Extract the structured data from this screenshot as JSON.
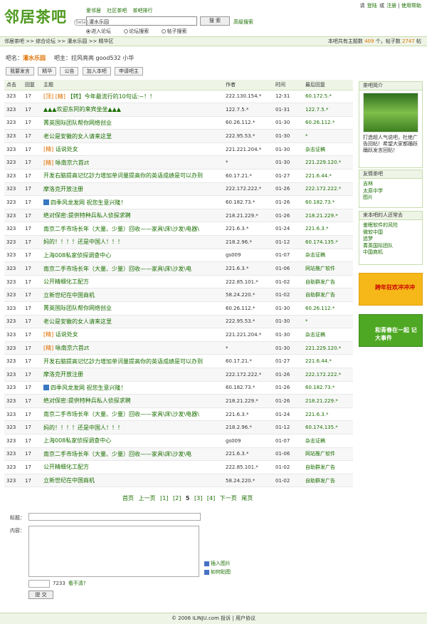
{
  "top_links": {
    "invite": "请",
    "login": "登陆",
    "or": "或",
    "register": "注册",
    "help": "使用帮助"
  },
  "logo": {
    "text": "邻居茶吧",
    "beta": "beta"
  },
  "nav": [
    "爱邻居",
    "社区茶吧",
    "茶吧排行"
  ],
  "search": {
    "value": "灌水乐园",
    "button": "搜 索",
    "advanced": "高级搜索"
  },
  "radios": [
    {
      "label": "进入论坛",
      "checked": true
    },
    {
      "label": "论坛搜索",
      "checked": false
    },
    {
      "label": "帖子搜索",
      "checked": false
    }
  ],
  "breadcrumb": "邻居茶吧 >> 综合论坛 >> 灌水乐园 >> 精华区",
  "stats": {
    "prefix": "本吧共有主题数",
    "topics": "409",
    "mid": "个，帖子数",
    "posts": "2747",
    "suffix": "帖"
  },
  "bar_info": {
    "label": "吧名：",
    "name": "灌水乐园",
    "owner": "吧主：拉风亮亮 good532 小华"
  },
  "tabs": [
    "我要发言",
    "精华",
    "公告",
    "加入本吧",
    "申请吧主"
  ],
  "columns": [
    "点击",
    "回复",
    "主题",
    "作者",
    "时间",
    "最后回复"
  ],
  "rows": [
    {
      "c": "323",
      "r": "17",
      "tag": "[顶] [精]",
      "t": "【转】今年最流行的10句话:~！！",
      "a": "222.130.154.*",
      "d": "12-31",
      "l": "60.172.5.*"
    },
    {
      "c": "323",
      "r": "17",
      "tag": "",
      "t": "▲▲▲欢迎东阿的来宾坐坐▲▲▲",
      "a": "122.7.5.*",
      "d": "01-31",
      "l": "122.7.5.*"
    },
    {
      "c": "323",
      "r": "17",
      "tag": "",
      "t": "菁英国际团队帮你网络创业",
      "a": "60.26.112.*",
      "d": "01-30",
      "l": "60.26.112.*"
    },
    {
      "c": "323",
      "r": "17",
      "tag": "",
      "t": "老公是安徽的女人请来这里",
      "a": "222.95.53.*",
      "d": "01-30",
      "l": "*"
    },
    {
      "c": "323",
      "r": "17",
      "tag": "[精]",
      "t": "话说处女",
      "a": "221.221.204.*",
      "d": "01-30",
      "l": "杂志证稿"
    },
    {
      "c": "323",
      "r": "17",
      "tag": "[精]",
      "t": "咏南京六首zt",
      "a": "*",
      "d": "01-30",
      "l": "221.229.120.*"
    },
    {
      "c": "323",
      "r": "17",
      "tag": "",
      "t": "开发右脑提高记忆訬力增加单词量提高你的英语成绩是可以办到",
      "a": "60.17.21.*",
      "d": "01-27",
      "l": "221.6.44.*"
    },
    {
      "c": "323",
      "r": "17",
      "tag": "",
      "t": "摩洛克开放注册",
      "a": "222.172.222.*",
      "d": "01-26",
      "l": "222.172.222.*"
    },
    {
      "c": "323",
      "r": "17",
      "tag": "icon",
      "t": "四季风龙发网  祝您生意兴隆！",
      "a": "60.182.73.*",
      "d": "01-26",
      "l": "60.182.73.*"
    },
    {
      "c": "323",
      "r": "17",
      "tag": "",
      "t": "绝对保密:提供特种兵私人侦探求聘",
      "a": "218.21.229.*",
      "d": "01-26",
      "l": "218.21.229.*"
    },
    {
      "c": "323",
      "r": "17",
      "tag": "",
      "t": "南京二手市场长年（大量、少量）回收——家具\\床\\沙发\\电器\\",
      "a": "221.6.3.*",
      "d": "01-24",
      "l": "221.6.3.*"
    },
    {
      "c": "323",
      "r": "17",
      "tag": "",
      "t": "妈的！！！！还是中国人！！！",
      "a": "218.2.96.*",
      "d": "01-12",
      "l": "60.174.135.*"
    },
    {
      "c": "323",
      "r": "17",
      "tag": "",
      "t": "上海008私家侦探调查中心",
      "a": "gs009",
      "d": "01-07",
      "l": "杂志证稿"
    },
    {
      "c": "323",
      "r": "17",
      "tag": "",
      "t": "南京二手市场长年（大量、少量）回收——家具\\床\\沙发\\电",
      "a": "221.6.3.*",
      "d": "01-06",
      "l": "网站推广软件"
    },
    {
      "c": "323",
      "r": "17",
      "tag": "",
      "t": "公开精细化工配方",
      "a": "222.85.101.*",
      "d": "01-02",
      "l": "自助群发广告"
    },
    {
      "c": "323",
      "r": "17",
      "tag": "",
      "t": "立新世纪在中国商机",
      "a": "58.24.220.*",
      "d": "01-02",
      "l": "自助群发广告"
    },
    {
      "c": "323",
      "r": "17",
      "tag": "",
      "t": "菁英国际团队帮你网络创业",
      "a": "60.26.112.*",
      "d": "01-30",
      "l": "60.26.112.*"
    },
    {
      "c": "323",
      "r": "17",
      "tag": "",
      "t": "老公是安徽的女人请来这里",
      "a": "222.95.53.*",
      "d": "01-30",
      "l": "*"
    },
    {
      "c": "323",
      "r": "17",
      "tag": "[精]",
      "t": "话说处女",
      "a": "221.221.204.*",
      "d": "01-30",
      "l": "杂志证稿"
    },
    {
      "c": "323",
      "r": "17",
      "tag": "[精]",
      "t": "咏南京六首zt",
      "a": "*",
      "d": "01-30",
      "l": "221.229.120.*"
    },
    {
      "c": "323",
      "r": "17",
      "tag": "",
      "t": "开发右脑提高记忆訬力增加单词量提高你的英语成绩是可以办到",
      "a": "60.17.21.*",
      "d": "01-27",
      "l": "221.6.44.*"
    },
    {
      "c": "323",
      "r": "17",
      "tag": "",
      "t": "摩洛克开放注册",
      "a": "222.172.222.*",
      "d": "01-26",
      "l": "222.172.222.*"
    },
    {
      "c": "323",
      "r": "17",
      "tag": "icon",
      "t": "四季风龙发网  祝您生意兴隆！",
      "a": "60.182.73.*",
      "d": "01-26",
      "l": "60.182.73.*"
    },
    {
      "c": "323",
      "r": "17",
      "tag": "",
      "t": "绝对保密:提供特种兵私人侦探求聘",
      "a": "218.21.229.*",
      "d": "01-26",
      "l": "218.21.229.*"
    },
    {
      "c": "323",
      "r": "17",
      "tag": "",
      "t": "南京二手市场长年（大量、少量）回收——家具\\床\\沙发\\电器\\",
      "a": "221.6.3.*",
      "d": "01-24",
      "l": "221.6.3.*"
    },
    {
      "c": "323",
      "r": "17",
      "tag": "",
      "t": "妈的！！！！还是中国人！！！",
      "a": "218.2.96.*",
      "d": "01-12",
      "l": "60.174.135.*"
    },
    {
      "c": "323",
      "r": "17",
      "tag": "",
      "t": "上海008私家侦探调查中心",
      "a": "gs009",
      "d": "01-07",
      "l": "杂志证稿"
    },
    {
      "c": "323",
      "r": "17",
      "tag": "",
      "t": "南京二手市场长年（大量、少量）回收——家具\\床\\沙发\\电",
      "a": "221.6.3.*",
      "d": "01-06",
      "l": "网站推广软件"
    },
    {
      "c": "323",
      "r": "17",
      "tag": "",
      "t": "公开精细化工配方",
      "a": "222.85.101.*",
      "d": "01-02",
      "l": "自助群发广告"
    },
    {
      "c": "323",
      "r": "17",
      "tag": "",
      "t": "立新世纪在中国商机",
      "a": "58.24.220.*",
      "d": "01-02",
      "l": "自助群发广告"
    }
  ],
  "pager": [
    "首页",
    "上一页",
    "[1]",
    "[2]",
    "5",
    "[3]",
    "[4]",
    "下一页",
    "尾页"
  ],
  "side_intro": {
    "title": "茶吧简介",
    "text": "打造超人气说吧，杜绝广告回帖！希望大家都踊跃踊跃发言回贴！"
  },
  "side_friends": {
    "title": "友情茶吧",
    "items": [
      "吉林",
      "太原中学",
      "图片"
    ]
  },
  "side_visitors": {
    "title": "来本吧的人还常去",
    "items": [
      "鉴眠软件的风险",
      "微软中国",
      "追梦",
      "菁英国际团队",
      "中国商机"
    ]
  },
  "ads": [
    "跨年狂欢冲冲冲",
    "和青春在一起 记大事件"
  ],
  "form": {
    "title_label": "标题：",
    "content_label": "内容：",
    "insert_image": "插入图片",
    "how_post": "如何贴图",
    "code": "7233",
    "unclear": "看不清?",
    "submit": "提 交"
  },
  "footer": {
    "copy": "© 2006 ILINJU.com",
    "complain": "投诉",
    "agreement": "用户协议"
  }
}
